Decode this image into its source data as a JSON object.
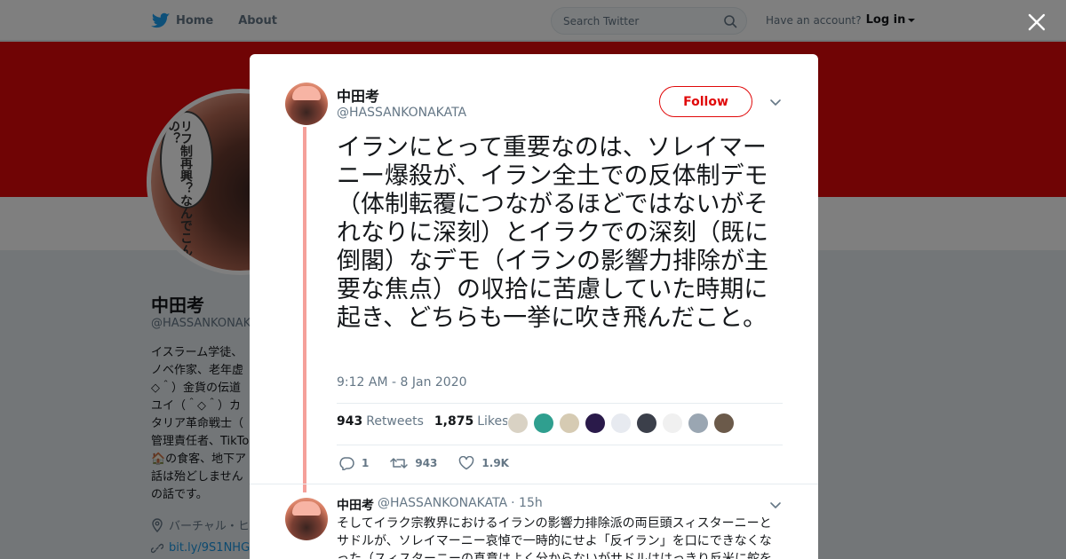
{
  "topbar": {
    "home_label": "Home",
    "about_label": "About",
    "search_placeholder": "Search Twitter",
    "account_prompt": "Have an account?",
    "login_label": "Log in"
  },
  "profile": {
    "name": "中田考",
    "handle": "@HASSANKONAKATA",
    "avatar_text": "リフ制再興？なんでこんなの？",
    "bio_lines": [
      "イスラーム学徒、",
      "ノベ作家、老年虚",
      "◇＾）金貨の伝道",
      "ユイ（＾◇＾）カ",
      "タリア革命戦士（",
      "管理責任者、TikTo",
      "🏠の食客、地下ア",
      "話は殆どしません",
      "の話です。"
    ],
    "location": "バーチャル・ヒ",
    "link": "bit.ly/9S1NHG"
  },
  "tweet": {
    "name": "中田考",
    "handle": "@HASSANKONAKATA",
    "follow_label": "Follow",
    "text": "イランにとって重要なのは、ソレイマーニー爆殺が、イラン全土での反体制デモ（体制転覆につながるほどではないがそれなりに深刻）とイラクでの深刻（既に倒閣）なデモ（イランの影響力排除が主要な焦点）の収拾に苦慮していた時期に起き、どちらも一挙に吹き飛んだこと。",
    "timestamp": "9:12 AM - 8 Jan 2020",
    "retweets_count": "943",
    "retweets_label": "Retweets",
    "likes_count": "1,875",
    "likes_label": "Likes",
    "reply_action_count": "1",
    "retweet_action_count": "943",
    "like_action_count": "1.9K",
    "liker_face_colors": [
      "#d9d2c4",
      "#2f9f8f",
      "#d6cbb3",
      "#2a1a4a",
      "#e7eaf0",
      "#3b3f4a",
      "#f0f0f0",
      "#9aa6b2",
      "#6b5a4a"
    ]
  },
  "reply": {
    "name": "中田考",
    "handle": "@HASSANKONAKATA",
    "time": "· 15h",
    "text": "そしてイラク宗教界におけるイランの影響力排除派の両巨頭スィスターニーとサドルが、ソレイマーニー哀悼で一時的にせよ「反イラン」を口にできなくなった（スィスターニーの真意はよく分からないがサドルははっきり反米に舵を切"
  },
  "colors": {
    "brand_red": "#e0090a",
    "thread_line": "#f5a09a",
    "link_blue": "#1b95e0",
    "muted": "#657786"
  }
}
